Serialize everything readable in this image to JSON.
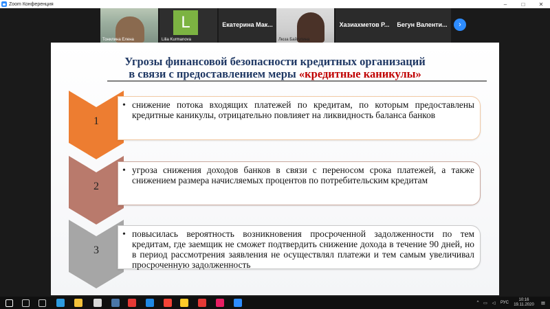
{
  "window": {
    "title": "Zoom Конференция",
    "minimize": "–",
    "maximize": "□",
    "close": "✕"
  },
  "participants": [
    {
      "name": "Тонилина Елена",
      "style": "video"
    },
    {
      "name": "Lilia Kurmanova",
      "initial": "L",
      "style": "avatar"
    },
    {
      "name": "Екатерина Мак...",
      "style": "name-only"
    },
    {
      "name": "Люза Байгулина",
      "style": "video"
    },
    {
      "name": "Хазиахметов Р...",
      "style": "name-only"
    },
    {
      "name": "Бегун Валенти...",
      "style": "name-only"
    }
  ],
  "next_page_icon": "chevron-right-icon",
  "slide": {
    "title_line1": "Угрозы финансовой безопасности кредитных организаций",
    "title_line2_prefix": "в связи с предоставлением меры ",
    "title_line2_highlight": "«кредитные каникулы»",
    "bullet": "•",
    "items": [
      {
        "num": "1",
        "color": "#ed7d31",
        "text": "снижение потока входящих платежей по кредитам, по которым предоставлены кредитные каникулы, отрицательно повлияет на ликвидность баланса банков"
      },
      {
        "num": "2",
        "color": "#b97a6c",
        "text": "угроза снижения доходов банков в связи с переносом срока платежей, а также снижением размера начисляемых процентов по потребительским кредитам"
      },
      {
        "num": "3",
        "color": "#a6a6a6",
        "text": "повысилась вероятность возникновения просроченной задолженности по тем кредитам, где заемщик не сможет подтвердить снижение дохода в течение 90 дней, но в период рассмотрения заявления не осуществлял платежи и тем самым увеличивал просроченную задолженность"
      }
    ]
  },
  "taskbar": {
    "apps": [
      {
        "name": "windows-start-icon",
        "color": "#ffffff"
      },
      {
        "name": "search-icon",
        "color": "#cccccc"
      },
      {
        "name": "task-view-icon",
        "color": "#cccccc"
      },
      {
        "name": "edge-icon",
        "color": "#2d9be0"
      },
      {
        "name": "file-explorer-icon",
        "color": "#f3c13a"
      },
      {
        "name": "store-icon",
        "color": "#d8d8d8"
      },
      {
        "name": "vk-icon",
        "color": "#4a76a8"
      },
      {
        "name": "yandex-browser-icon",
        "color": "#e53935"
      },
      {
        "name": "mail-icon",
        "color": "#1e88e5"
      },
      {
        "name": "yandex-icon",
        "color": "#f44336"
      },
      {
        "name": "mail-open-icon",
        "color": "#ffca28"
      },
      {
        "name": "opera-icon",
        "color": "#e53935"
      },
      {
        "name": "drop-icon",
        "color": "#e91e63"
      },
      {
        "name": "zoom-icon",
        "color": "#2d8cff"
      }
    ],
    "lang": "РУС",
    "time": "10:16",
    "date": "19.11.2020"
  }
}
